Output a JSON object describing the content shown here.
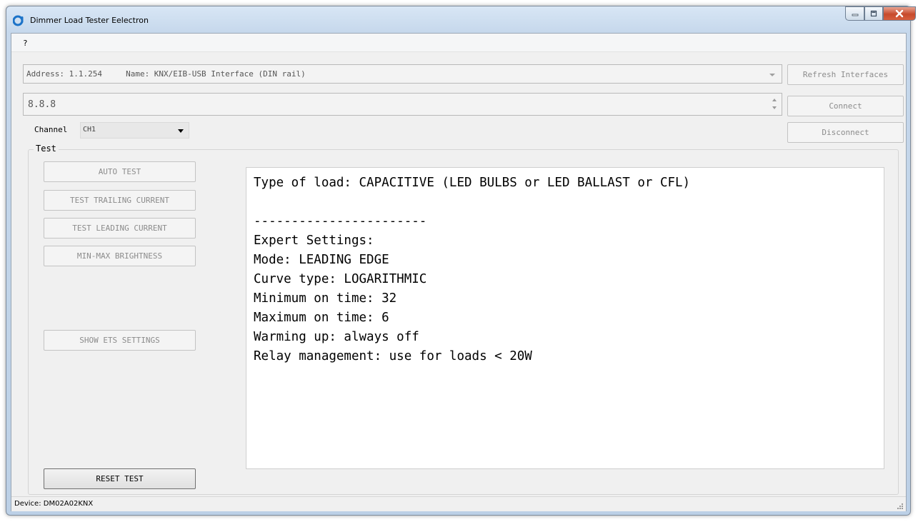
{
  "window": {
    "title": "Dimmer Load Tester Eelectron",
    "accent": "#1c73c8"
  },
  "menu": {
    "help": "?"
  },
  "interface": {
    "selected": "Address: 1.1.254     Name: KNX/EIB-USB Interface (DIN rail)",
    "refresh_label": "Refresh Interfaces"
  },
  "address": {
    "value": "8.8.8",
    "connect_label": "Connect",
    "disconnect_label": "Disconnect"
  },
  "channel": {
    "label": "Channel",
    "selected": "CH1"
  },
  "test": {
    "group_label": "Test",
    "buttons": [
      "AUTO TEST",
      "TEST TRAILING CURRENT",
      "TEST LEADING CURRENT",
      "MIN-MAX BRIGHTNESS",
      "SHOW ETS SETTINGS"
    ],
    "reset_label": "RESET TEST"
  },
  "output": {
    "lines": [
      "Type of load: CAPACITIVE (LED BULBS or LED BALLAST or CFL)",
      "",
      "-----------------------",
      "Expert Settings:",
      "Mode: LEADING EDGE",
      "Curve type: LOGARITHMIC",
      "Minimum on time: 32",
      "Maximum on time: 6",
      "Warming up: always off",
      "Relay management: use for loads < 20W"
    ]
  },
  "status": {
    "device": "Device: DM02A02KNX"
  }
}
